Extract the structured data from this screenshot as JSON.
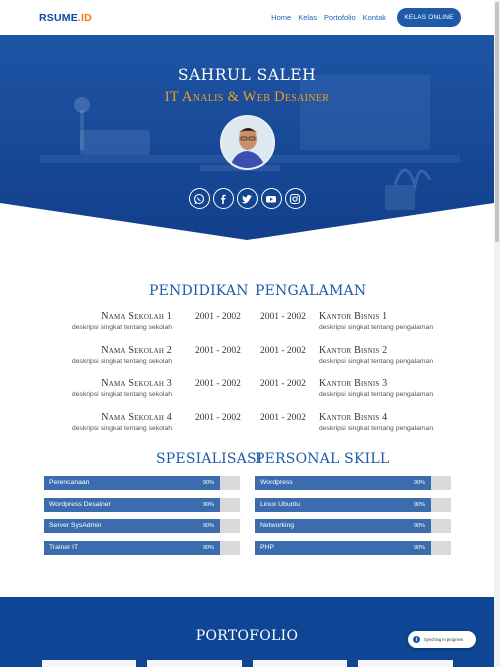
{
  "brand": {
    "logo_main": "RSUME",
    "logo_dot": ".",
    "logo_suffix": "ID"
  },
  "nav": {
    "links": [
      "Home",
      "Kelas",
      "Portofolio",
      "Kontak"
    ],
    "cta": "KELAS ONLINE"
  },
  "hero": {
    "name": "SAHRUL SALEH",
    "title": "IT Analis & Web Desainer",
    "socials": [
      "whatsapp-icon",
      "facebook-icon",
      "twitter-icon",
      "youtube-icon",
      "instagram-icon"
    ]
  },
  "pendidikan": {
    "title": "PENDIDIKAN",
    "items": [
      {
        "name": "Nama Sekolah 1",
        "desc": "deskripsi singkat tentang sekolah",
        "year": "2001 - 2002"
      },
      {
        "name": "Nama Sekolah 2",
        "desc": "deskripsi singkat tentang sekolah",
        "year": "2001 - 2002"
      },
      {
        "name": "Nama Sekolah 3",
        "desc": "deskripsi singkat tentang sekolah",
        "year": "2001 - 2002"
      },
      {
        "name": "Nama Sekolah 4",
        "desc": "deskripsi singkat tentang sekolah",
        "year": "2001 - 2002"
      }
    ]
  },
  "pengalaman": {
    "title": "PENGALAMAN",
    "items": [
      {
        "name": "Kantor Bisnis 1",
        "desc": "deskripsi singkat tentang pengalaman",
        "year": "2001 - 2002"
      },
      {
        "name": "Kantor Bisnis 2",
        "desc": "deskripsi singkat tentang pengalaman",
        "year": "2001 - 2002"
      },
      {
        "name": "Kantor Bisnis 3",
        "desc": "deskripsi singkat tentang pengalaman",
        "year": "2001 - 2002"
      },
      {
        "name": "Kantor Bisnis 4",
        "desc": "deskripsi singkat tentang pengalaman",
        "year": "2001 - 2002"
      }
    ]
  },
  "spesialisasi": {
    "title": "SPESIALISASI",
    "items": [
      {
        "label": "Perencanaan",
        "pct": "90%",
        "value": 90
      },
      {
        "label": "Wordpress Desainer",
        "pct": "90%",
        "value": 90
      },
      {
        "label": "Server SysAdmin",
        "pct": "90%",
        "value": 90
      },
      {
        "label": "Trainer IT",
        "pct": "90%",
        "value": 90
      }
    ]
  },
  "personal_skill": {
    "title": "PERSONAL SKILL",
    "items": [
      {
        "label": "Wordpress",
        "pct": "90%",
        "value": 90
      },
      {
        "label": "Linux Ubuntu",
        "pct": "90%",
        "value": 90
      },
      {
        "label": "Networking",
        "pct": "90%",
        "value": 90
      },
      {
        "label": "PHP",
        "pct": "90%",
        "value": 90
      }
    ]
  },
  "portofolio": {
    "title": "PORTOFOLIO"
  },
  "sync": {
    "text": "Synching in progress",
    "icon": "info-icon"
  },
  "colors": {
    "primary": "#1e5aa8",
    "accent": "#f59e1b",
    "bar_fill": "#3b6dae",
    "bar_track": "#d9d9d9",
    "footer_bg": "#0e4595"
  }
}
